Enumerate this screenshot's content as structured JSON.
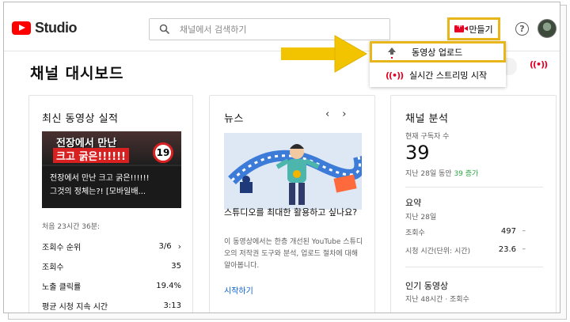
{
  "header": {
    "logo_text": "Studio",
    "search_placeholder": "채널에서 검색하기",
    "create_label": "만들기",
    "help_glyph": "?"
  },
  "menu": {
    "upload_label": "동영상 업로드",
    "live_label": "실시간 스트리밍 시작",
    "live_glyph": "((•))"
  },
  "page": {
    "title": "채널 대시보드"
  },
  "latest_video": {
    "title": "최신 동영상 실적",
    "thumb_line1": "전장에서 만난",
    "thumb_line2": "크고 굵은!!!!!!",
    "thumb_badge": "19",
    "caption_line1": "전장에서 만난 크고 굵은!!!!!!",
    "caption_line2": "그것의 정체는?! [모바일배...",
    "since": "처음 23시간 36분:",
    "metrics": [
      {
        "label": "조회수 순위",
        "value": "3/6",
        "chevron": "›"
      },
      {
        "label": "조회수",
        "value": "35"
      },
      {
        "label": "노출 클릭률",
        "value": "19.4%"
      },
      {
        "label": "평균 시청 지속 시간",
        "value": "3:13"
      }
    ]
  },
  "news": {
    "title": "뉴스",
    "prev": "‹",
    "next": "›",
    "headline": "스튜디오를 최대한 활용하고 싶나요?",
    "body": "이 동영상에서는 한층 개선된 YouTube 스튜디오의 저작권 도구와 분석, 업로드 절차에 대해 알아봅니다.",
    "link": "시작하기"
  },
  "analytics": {
    "title": "채널 분석",
    "subs_label": "현재 구독자 수",
    "subs_value": "39",
    "subs_change_prefix": "지난 28일 동안 ",
    "subs_change": "39 증가",
    "summary_title": "요약",
    "summary_period": "지난 28일",
    "rows": [
      {
        "label": "조회수",
        "value": "497",
        "dash": "–"
      },
      {
        "label": "시청 시간(단위: 시간)",
        "value": "23.6",
        "dash": "–"
      }
    ],
    "popular_title": "인기 동영상",
    "popular_sub": "지난 48시간 · 조회수"
  },
  "colors": {
    "highlight": "#e8b51a",
    "youtube_red": "#ff0000",
    "link": "#065fd4",
    "positive": "#2ba640"
  }
}
